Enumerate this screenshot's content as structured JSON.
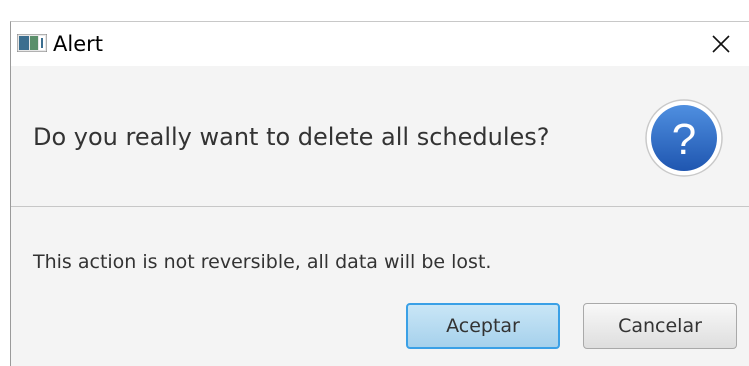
{
  "window": {
    "title": "Alert",
    "app_icon": "java-window-icon",
    "close_icon": "close-icon"
  },
  "header": {
    "text": "Do you really want to delete all schedules?",
    "icon": "question-icon",
    "icon_color": "#2f6fc9"
  },
  "content": {
    "text": "This action is not reversible, all data will be lost."
  },
  "buttons": {
    "accept_label": "Aceptar",
    "cancel_label": "Cancelar",
    "accept_border_color": "#3aa0e6"
  }
}
